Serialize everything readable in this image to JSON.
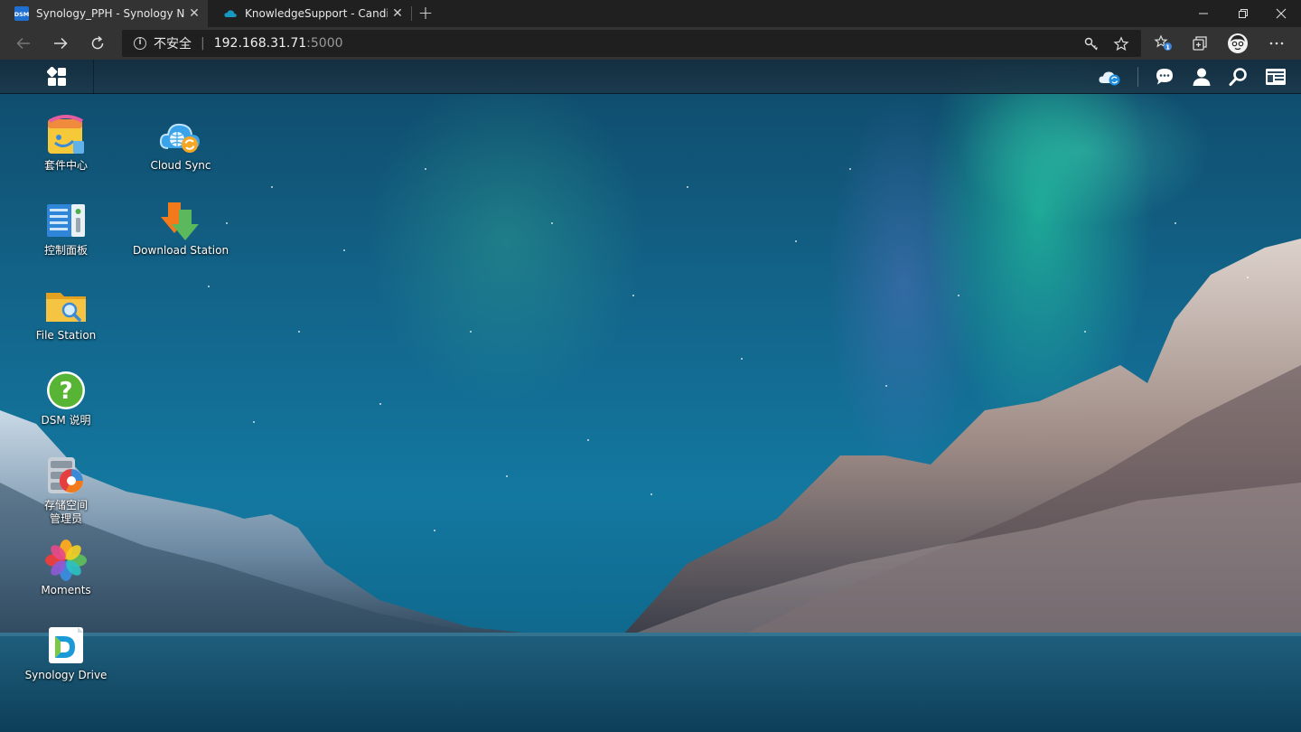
{
  "browser": {
    "tabs": [
      {
        "title": "Synology_PPH - Synology NAS",
        "active": true
      },
      {
        "title": "KnowledgeSupport - Candidate",
        "active": false
      }
    ],
    "address": {
      "security_label": "不安全",
      "host": "192.168.31.71",
      "port": ":5000"
    }
  },
  "desktop": {
    "icons": [
      {
        "name": "package-center",
        "label": "套件中心"
      },
      {
        "name": "cloud-sync",
        "label": "Cloud Sync"
      },
      {
        "name": "control-panel",
        "label": "控制面板"
      },
      {
        "name": "download-station",
        "label": "Download Station"
      },
      {
        "name": "file-station",
        "label": "File Station"
      },
      {
        "name": "dsm-help",
        "label": "DSM 说明"
      },
      {
        "name": "storage-manager",
        "label": "存储空间\n管理员"
      },
      {
        "name": "moments",
        "label": "Moments"
      },
      {
        "name": "synology-drive",
        "label": "Synology Drive"
      }
    ]
  },
  "colors": {
    "chrome_dark": "#202020",
    "chrome_tab": "#333333",
    "url_bg": "#1f1f1f",
    "dsm_taskbar": "#1c384a"
  }
}
